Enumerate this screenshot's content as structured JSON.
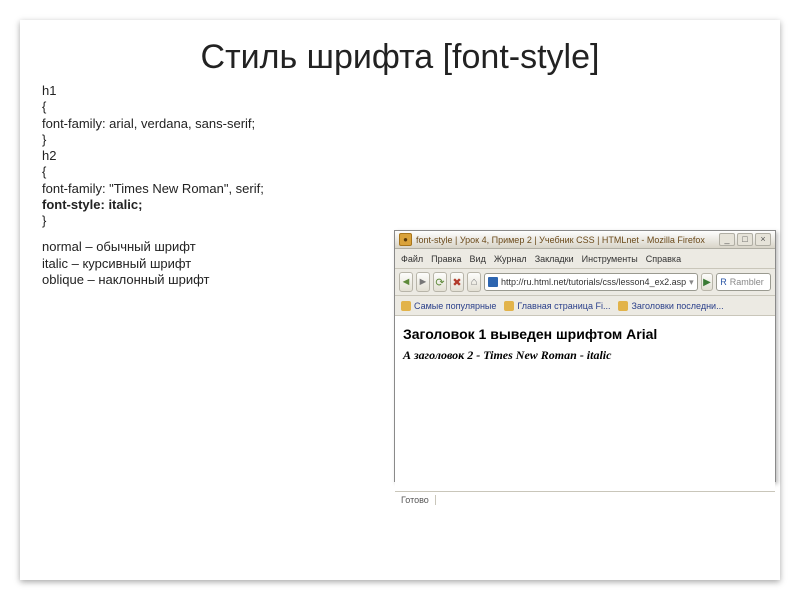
{
  "slide": {
    "title": "Стиль шрифта [font-style]",
    "code": {
      "l1": "h1",
      "l2": "{",
      "l3": "font-family: arial, verdana, sans-serif;",
      "l4": "}",
      "l5": "h2",
      "l6": "{",
      "l7": "font-family: \"Times New Roman\", serif;",
      "l8": "font-style: italic;",
      "l9": "}"
    },
    "desc": {
      "l1": "normal – обычный шрифт",
      "l2": "italic – курсивный шрифт",
      "l3": "oblique – наклонный шрифт"
    }
  },
  "browser": {
    "title": "font-style | Урок 4, Пример 2 | Учебник CSS | HTMLnet - Mozilla Firefox",
    "menu": {
      "file": "Файл",
      "edit": "Правка",
      "view": "Вид",
      "history": "Журнал",
      "bookmarks": "Закладки",
      "tools": "Инструменты",
      "help": "Справка"
    },
    "address": "http://ru.html.net/tutorials/css/lesson4_ex2.asp",
    "search_placeholder": "Rambler",
    "bookmarks": {
      "b1": "Самые популярные",
      "b2": "Главная страница Fi...",
      "b3": "Заголовки последни..."
    },
    "page": {
      "h1": "Заголовок 1 выведен шрифтом Arial",
      "h2": "А заголовок 2 - Times New Roman - italic"
    },
    "status": "Готово"
  }
}
